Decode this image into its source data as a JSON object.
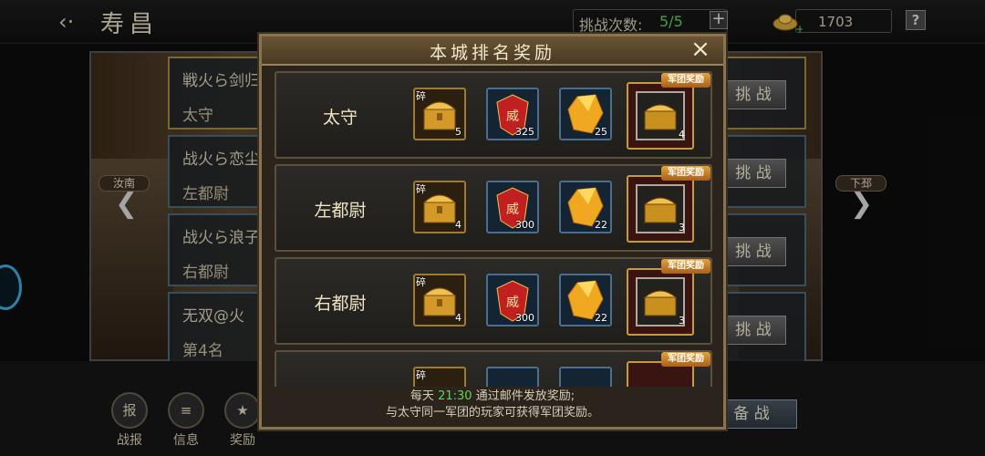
{
  "header": {
    "city_name": "寿昌",
    "challenge_label": "挑战次数:",
    "challenge_count": "5/5",
    "gold_amount": "1703"
  },
  "scene": {
    "prev_city": "汝南",
    "next_city": "下邳"
  },
  "rank_list": [
    {
      "name": "戦火ら剑归",
      "role": "太守",
      "button": "挑 战"
    },
    {
      "name": "战火ら恋尘",
      "role": "左都尉",
      "button": "挑 战"
    },
    {
      "name": "战火ら浪子",
      "role": "右都尉",
      "button": "挑 战"
    },
    {
      "name": "无双@火",
      "role": "第4名",
      "button": "挑 战"
    }
  ],
  "bottom_tabs": [
    {
      "icon": "报",
      "label": "战报"
    },
    {
      "icon": "≡",
      "label": "信息"
    },
    {
      "icon": "★",
      "label": "奖励"
    }
  ],
  "prepare_button": "备 战",
  "modal": {
    "title": "本城排名奖励",
    "close": "×",
    "legion_tag": "军团奖励",
    "fragment_tag": "碎",
    "rows": [
      {
        "rank": "太守",
        "chest": "5",
        "token": "325",
        "crystal": "25",
        "legion": "4"
      },
      {
        "rank": "左都尉",
        "chest": "4",
        "token": "300",
        "crystal": "22",
        "legion": "3"
      },
      {
        "rank": "右都尉",
        "chest": "4",
        "token": "300",
        "crystal": "22",
        "legion": "3"
      }
    ],
    "footer_line1_pre": "每天",
    "footer_time": "21:30",
    "footer_line1_post": "通过邮件发放奖励;",
    "footer_line2": "与太守同一军团的玩家可获得军团奖励。"
  },
  "colors": {
    "accent_green": "#5fd45a",
    "legion_orange": "#e2a23a"
  }
}
